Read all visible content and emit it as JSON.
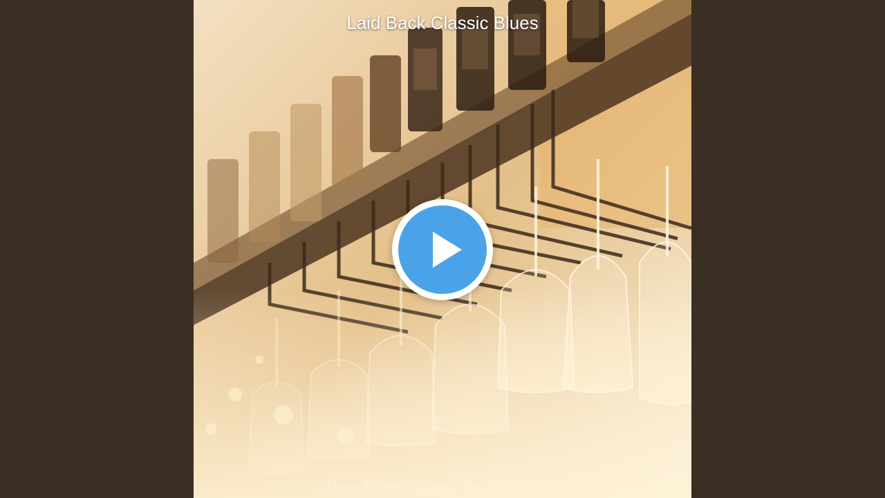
{
  "video": {
    "title": "Laid Back Classic Blues",
    "album_caption": "(Slow Blues) Music for Retro Bars"
  },
  "colors": {
    "background": "#3a2f22",
    "play_button_fill": "#4aa3e8",
    "play_button_ring": "#ffffff"
  },
  "icons": {
    "play": "play-triangle-icon"
  }
}
